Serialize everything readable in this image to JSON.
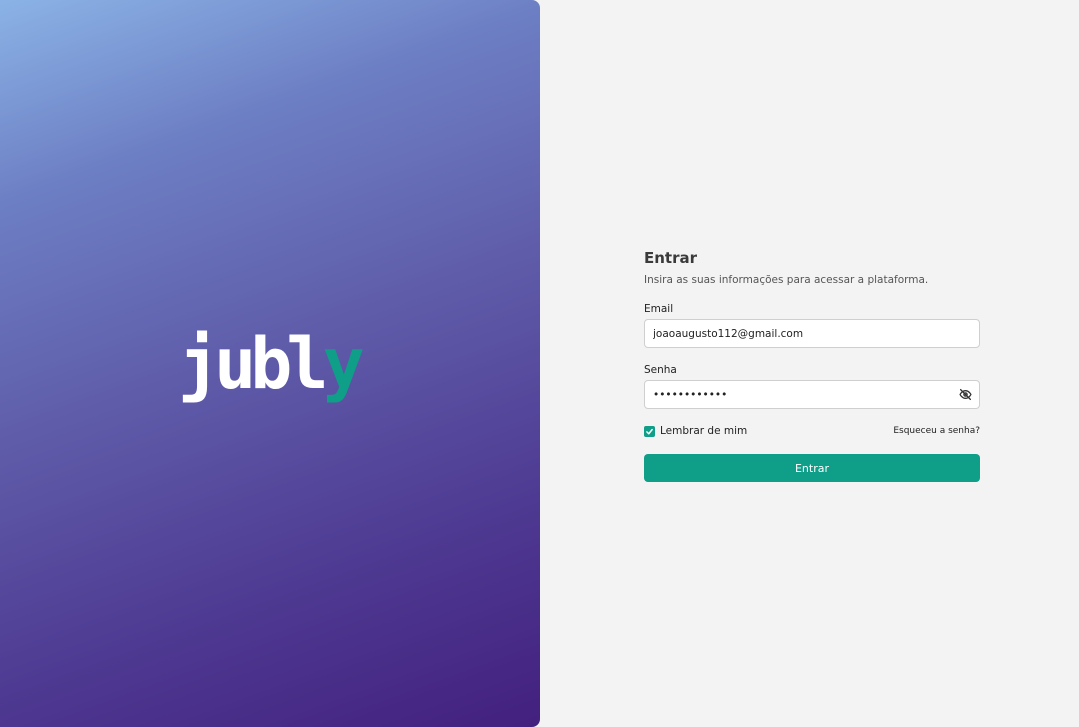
{
  "brand": {
    "logo_main": "jubl",
    "logo_accent": "y",
    "accent_color": "#0f9e87"
  },
  "login": {
    "title": "Entrar",
    "subtitle": "Insira as suas informações para acessar a plataforma.",
    "email_label": "Email",
    "email_value": "joaoaugusto112@gmail.com",
    "password_label": "Senha",
    "password_value": "••••••••••••",
    "password_toggle_icon": "eye-off-icon",
    "remember_label": "Lembrar de mim",
    "remember_checked": true,
    "forgot_label": "Esqueceu a senha?",
    "submit_label": "Entrar"
  }
}
